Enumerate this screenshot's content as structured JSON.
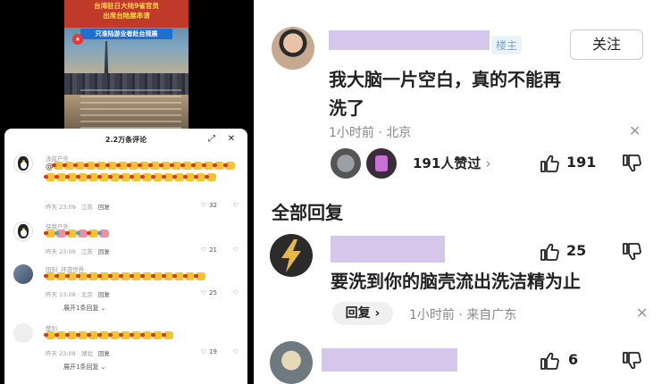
{
  "video": {
    "headline_1": "台湾驻日大陆9省官员",
    "headline_2": "出席台陆展串请",
    "banner": "只准陆游业者赴台观展",
    "logo": "★"
  },
  "left_sheet": {
    "title": "2.2万条评论",
    "expand_icon": "⤢",
    "close_icon": "✕",
    "comments": [
      {
        "name": "浅蓝户外",
        "prefix": "@",
        "emoji_count": 33,
        "emoji_style": "clap",
        "time": "昨天 23:09",
        "location": "江苏",
        "reply": "回复",
        "likes": "32"
      },
      {
        "name": "侠我户外",
        "prefix": "",
        "emoji_count": 6,
        "emoji_style": "mixed",
        "time": "昨天 23:09",
        "location": "江苏",
        "reply": "回复",
        "likes": "21"
      },
      {
        "name": "田刻",
        "name_extra": "环游世界",
        "prefix": "",
        "emoji_count": 15,
        "emoji_style": "clap",
        "time": "昨天 23:08",
        "location": "北京",
        "reply": "回复",
        "likes": "25",
        "more": "展开1条回复"
      },
      {
        "name": "楚利",
        "prefix": "",
        "emoji_count": 12,
        "emoji_style": "clap",
        "time": "昨天 23:08",
        "location": "湖北",
        "reply": "回复",
        "likes": "19",
        "more": "展开1条回复"
      }
    ]
  },
  "right": {
    "op": {
      "badge": "楼主",
      "follow": "关注",
      "text_line1": "我大脑一片空白，真的不能再",
      "text_line2": "洗了",
      "time": "1小时前",
      "location": "北京",
      "dismiss": "✕",
      "likes_summary": "191人赞过",
      "likes_arrow": "›",
      "likes": "191"
    },
    "section_title": "全部回复",
    "reply1": {
      "likes": "25",
      "text": "要洗到你的脑壳流出洗洁精为止",
      "reply_label": "回复 ›",
      "time": "1小时前",
      "location": "来自广东",
      "dismiss": "✕"
    },
    "reply2": {
      "likes": "6"
    }
  }
}
